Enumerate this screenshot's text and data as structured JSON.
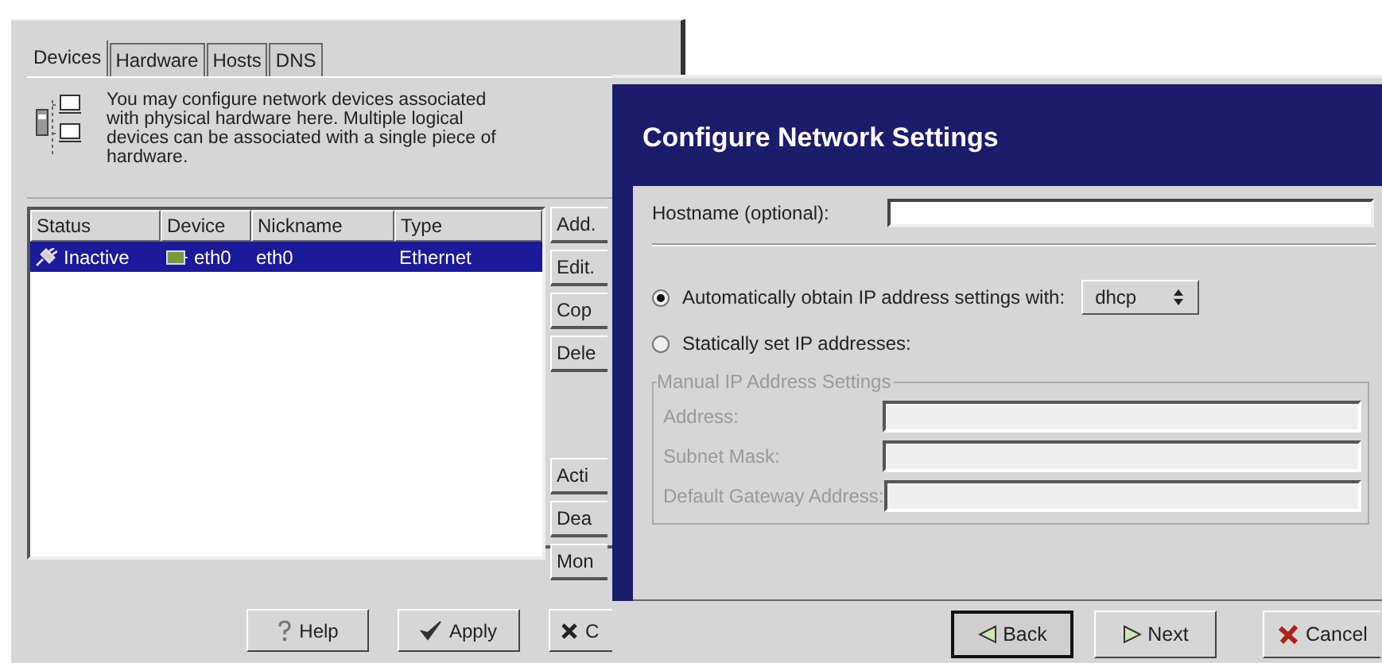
{
  "network_window": {
    "tabs": [
      {
        "label": "Devices",
        "selected": true
      },
      {
        "label": "Hardware",
        "selected": false
      },
      {
        "label": "Hosts",
        "selected": false
      },
      {
        "label": "DNS",
        "selected": false
      }
    ],
    "description": "You may configure network devices associated with physical hardware here. Multiple logical devices can be associated with a single piece of hardware.",
    "table": {
      "columns": [
        "Status",
        "Device",
        "Nickname",
        "Type"
      ],
      "rows": [
        {
          "status": "Inactive",
          "device": "eth0",
          "nickname": "eth0",
          "type": "Ethernet",
          "selected": true
        }
      ]
    },
    "side_buttons": [
      "Add.",
      "Edit.",
      "Cop",
      "Dele",
      "Acti",
      "Dea",
      "Mon"
    ],
    "bottom_buttons": [
      {
        "label": "Help",
        "kind": "help"
      },
      {
        "label": "Apply",
        "kind": "apply"
      },
      {
        "label": "C",
        "kind": "close"
      }
    ]
  },
  "wizard": {
    "title": "Configure Network Settings",
    "hostname": {
      "label": "Hostname (optional):"
    },
    "options": [
      {
        "label": "Automatically obtain IP address settings with:",
        "selected": true,
        "dropdown": "dhcp"
      },
      {
        "label": "Statically set IP addresses:",
        "selected": false
      }
    ],
    "manual_group": {
      "title": "Manual IP Address Settings",
      "disabled": true,
      "fields": [
        {
          "label": "Address:"
        },
        {
          "label": "Subnet Mask:"
        },
        {
          "label": "Default Gateway Address:"
        }
      ]
    },
    "buttons": [
      {
        "label": "Back",
        "kind": "back",
        "focused": true
      },
      {
        "label": "Next",
        "kind": "next",
        "focused": false
      },
      {
        "label": "Cancel",
        "kind": "cancel",
        "focused": false
      }
    ]
  }
}
